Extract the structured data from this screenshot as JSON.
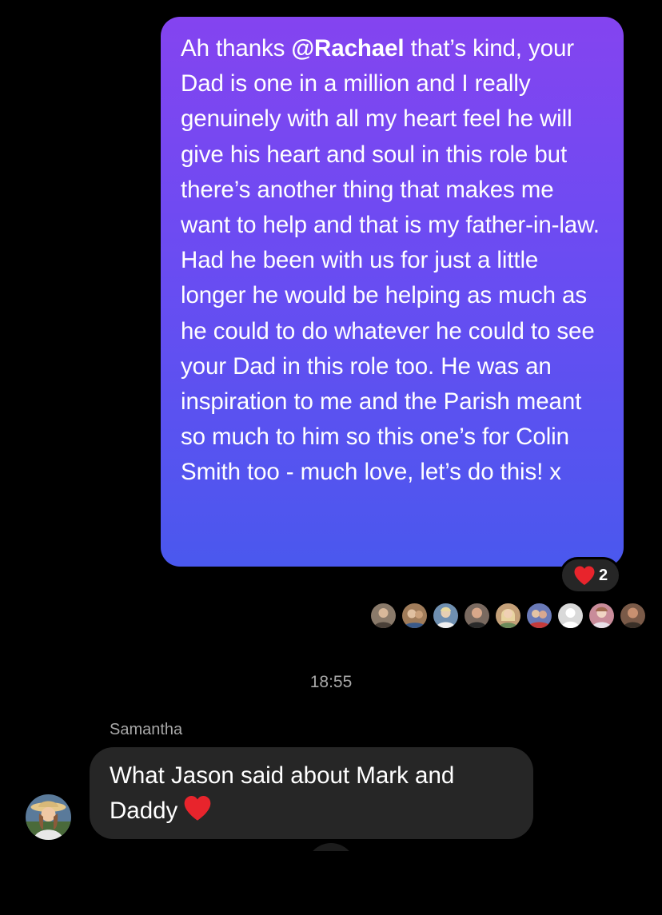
{
  "thread": {
    "outgoing_message": {
      "segments": [
        {
          "text": "Ah thanks ",
          "style": "normal"
        },
        {
          "text": "@Rachael",
          "style": "mention"
        },
        {
          "text": " that’s kind, your Dad is one in a million and I really genuinely with all my heart feel he will give his heart and soul in this role but there’s another thing that makes me want to help and that is my father-in-law. Had he been with us for just a little longer he would be helping as much as he could to do whatever he could to see your Dad in this role too. He was an inspiration to me and the Parish meant so much to him so this one’s for Colin Smith too - much love, let’s do this! x",
          "style": "normal"
        }
      ],
      "reaction": {
        "icon": "heart-icon",
        "count": "2"
      }
    },
    "seen_by_count": 9,
    "seen_by": [
      {
        "icon": "user-avatar-photo",
        "color": "#8a7a6a"
      },
      {
        "icon": "user-avatar-photo",
        "color": "#a07c5a"
      },
      {
        "icon": "user-avatar-photo",
        "color": "#6f8fb0"
      },
      {
        "icon": "user-avatar-photo",
        "color": "#7a6a60"
      },
      {
        "icon": "user-avatar-photo",
        "color": "#c4a078"
      },
      {
        "icon": "user-avatar-photo",
        "color": "#6a7ab8"
      },
      {
        "icon": "default-avatar-icon",
        "color": "#d9d9d9"
      },
      {
        "icon": "user-avatar-photo",
        "color": "#c98c9a"
      },
      {
        "icon": "user-avatar-photo",
        "color": "#7a5a48"
      }
    ],
    "timestamp": "18:55",
    "incoming_message": {
      "sender": "Samantha",
      "text": "What Jason said about Mark and Daddy",
      "emoji": "heart-icon"
    }
  },
  "colors": {
    "background": "#000000",
    "outgoing_gradient_top": "#8444f0",
    "outgoing_gradient_bottom": "#4a58ee",
    "incoming_bubble": "#262626",
    "secondary_text": "#a8a8a8",
    "heart": "#e8242c"
  }
}
